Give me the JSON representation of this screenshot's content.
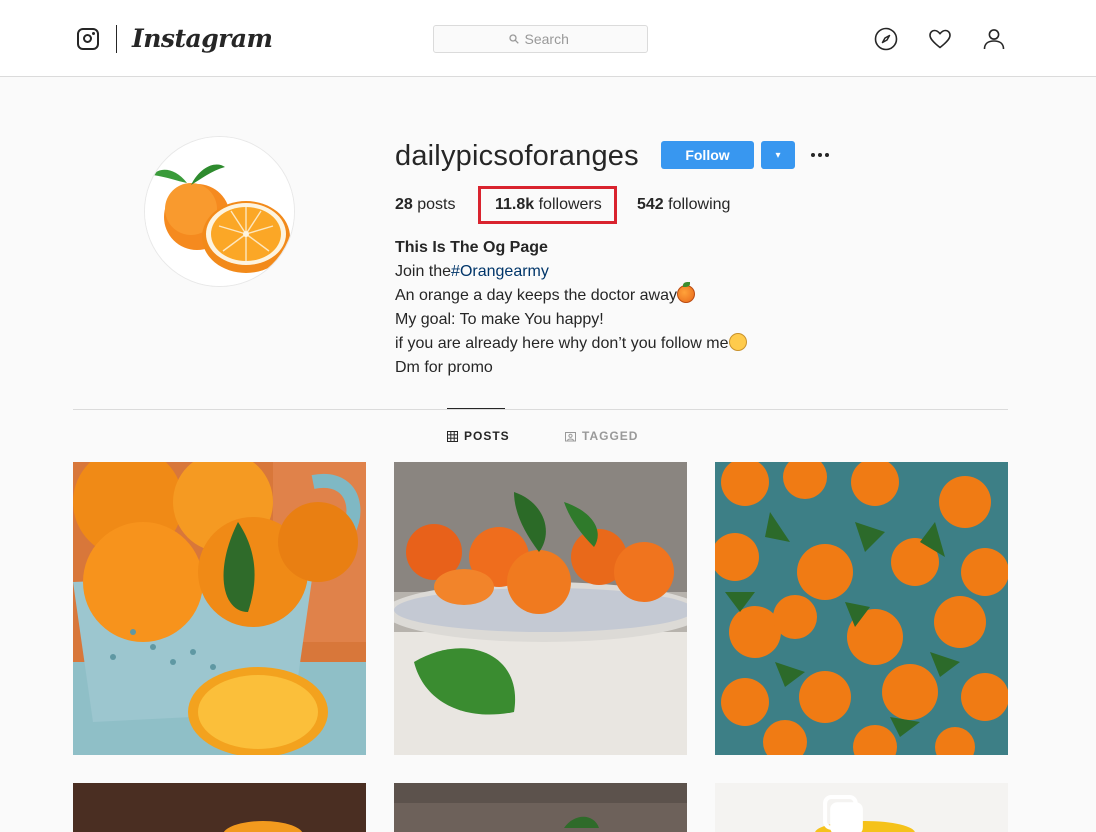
{
  "nav": {
    "brand": "Instagram",
    "search_placeholder": "Search",
    "icons": [
      "instagram-logo-icon",
      "search-icon",
      "compass-icon",
      "heart-icon",
      "user-icon"
    ]
  },
  "profile": {
    "username": "dailypicsoforanges",
    "follow_label": "Follow",
    "dropdown_label": "▾",
    "stats": {
      "posts_count": "28",
      "posts_label": "posts",
      "followers_count": "11.8k",
      "followers_label": "followers",
      "following_count": "542",
      "following_label": "following"
    },
    "bio": {
      "name": "This Is The Og Page",
      "line1_prefix": "Join the",
      "line1_hashtag": "#Orangearmy",
      "line2": "An orange a day keeps the doctor away",
      "line3": "My goal: To make You happy!",
      "line4": "if you are already here why don’t you follow me",
      "line5": "Dm for promo"
    }
  },
  "tabs": [
    {
      "label": "POSTS",
      "active": true
    },
    {
      "label": "TAGGED",
      "active": false
    }
  ],
  "colors": {
    "accent": "#3897f0",
    "highlight": "#d9232e",
    "hashtag": "#003569",
    "text": "#262626",
    "muted": "#999999"
  }
}
